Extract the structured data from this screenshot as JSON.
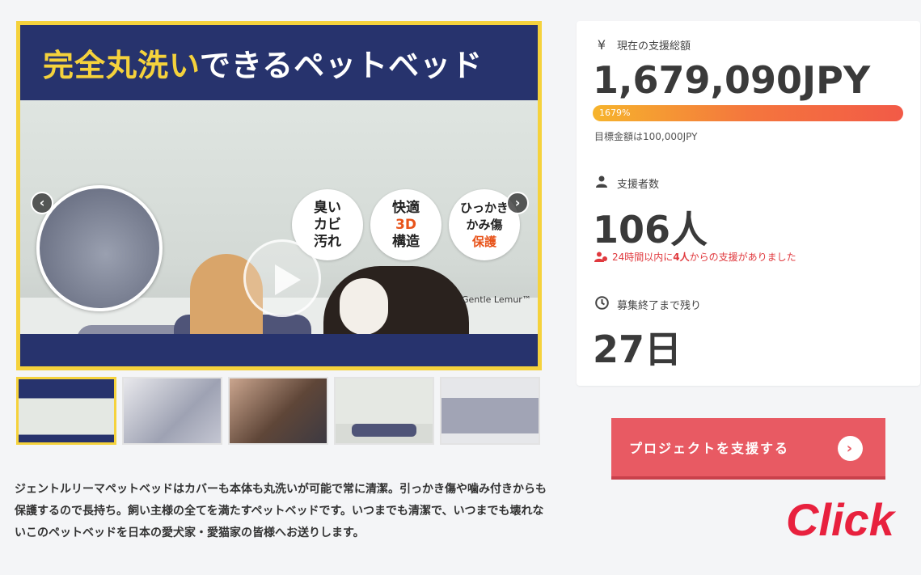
{
  "hero": {
    "title_highlight": "完全丸洗い",
    "title_rest": "できるペットベッド",
    "bubbles": [
      {
        "l1": "臭い",
        "l2": "カビ",
        "l3": "汚れ"
      },
      {
        "l1": "快適",
        "l2": "3D",
        "l3": "構造"
      },
      {
        "l1": "ひっかき",
        "l2": "かみ傷",
        "l3": "保護"
      }
    ],
    "brand": "Gentle Lemur™",
    "prev": "‹",
    "next": "›"
  },
  "description": "ジェントルリーマペットベッドはカバーも本体も丸洗いが可能で常に清潔。引っかき傷や噛み付きからも保護するので長持ち。飼い主様の全てを満たすペットベッドです。いつまでも清潔で、いつまでも壊れないこのペットベッドを日本の愛犬家・愛猫家の皆様へお送りします。",
  "stats": {
    "total_icon": "¥",
    "total_label": "現在の支援総額",
    "total_value": "1,679,090JPY",
    "progress_percent": 1679,
    "progress_label": "1679%",
    "goal_text": "目標金額は100,000JPY",
    "backers_label": "支援者数",
    "backers_value": "106人",
    "recent_prefix": "24時間以内に",
    "recent_count": "4人",
    "recent_suffix": "からの支援がありました",
    "remaining_label": "募集終了まで残り",
    "remaining_value": "27日"
  },
  "cta": {
    "label": "プロジェクトを支援する",
    "arrow": "›"
  },
  "click_text": "Click",
  "colors": {
    "brand_yellow": "#f5d23c",
    "navy": "#27336d",
    "cta": "#e85a63",
    "click": "#e8213e",
    "alert": "#e0393e"
  }
}
